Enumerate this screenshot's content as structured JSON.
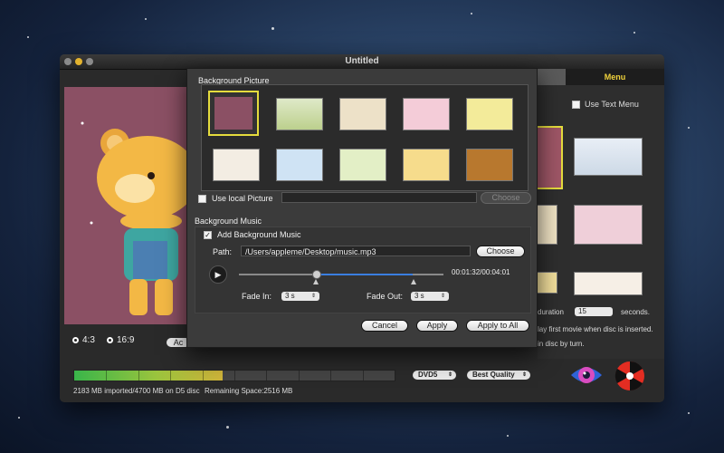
{
  "window": {
    "title": "Untitled"
  },
  "left": {
    "ratio_4_3": "4:3",
    "ratio_16_9": "16:9",
    "add_button": "Ac"
  },
  "right_panel": {
    "menu_tab": "Menu",
    "use_text_menu": "Use Text Menu",
    "duration_label": "duration",
    "duration_value": "15",
    "seconds_label": "seconds.",
    "text_line1": "lay first movie when disc is inserted.",
    "text_line2": "in disc by turn."
  },
  "bottom": {
    "imported_text": "2183 MB imported/4700 MB on D5 disc",
    "remaining_text": "Remaining Space:2516 MB",
    "disc_type": "DVD5",
    "quality": "Best Quality",
    "capacity_fraction": 0.464
  },
  "dialog": {
    "bg_picture_label": "Background Picture",
    "use_local_picture": "Use local Picture",
    "choose_disabled": "Choose",
    "bg_music_label": "Background Music",
    "add_bg_music": "Add Background Music",
    "path_label": "Path:",
    "path_value": "/Users/appleme/Desktop/music.mp3",
    "choose": "Choose",
    "time": "00:01:32/00:04:01",
    "fade_in_label": "Fade In:",
    "fade_in_value": "3 s",
    "fade_out_label": "Fade Out:",
    "fade_out_value": "3 s",
    "cancel": "Cancel",
    "apply": "Apply",
    "apply_all": "Apply to All"
  },
  "thumbnails": [
    "bear",
    "bike",
    "cow",
    "girl",
    "tulips",
    "castle",
    "globe",
    "cartoon",
    "girl-2",
    "autumn"
  ]
}
